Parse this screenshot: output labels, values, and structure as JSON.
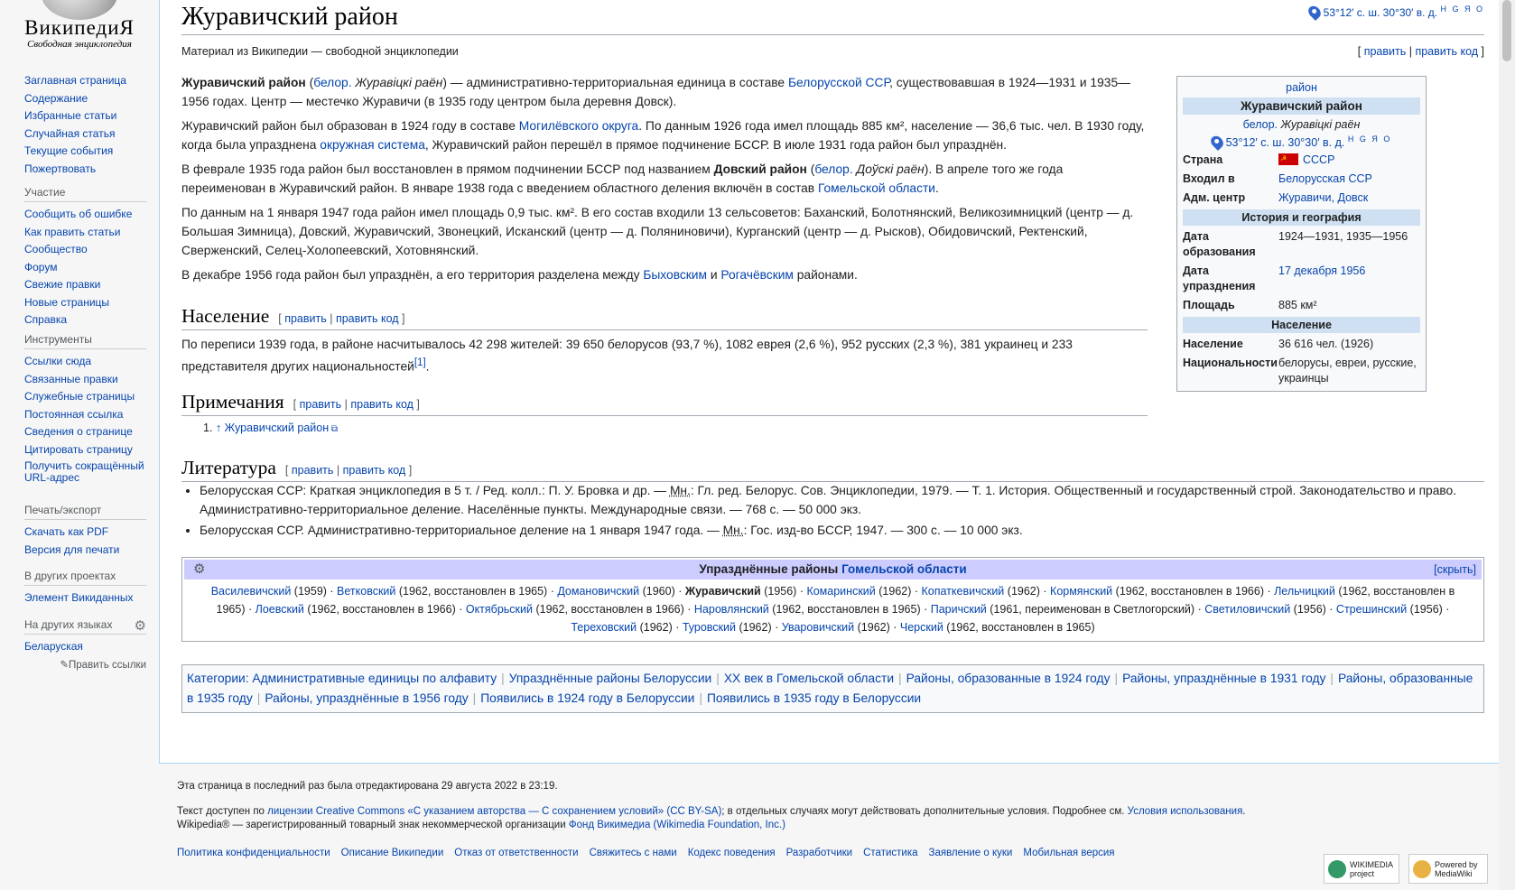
{
  "logo": {
    "wordmark": "ВикипедиЯ",
    "tagline": "Свободная энциклопедия"
  },
  "sidebar": {
    "nav": [
      "Заглавная страница",
      "Содержание",
      "Избранные статьи",
      "Случайная статья",
      "Текущие события",
      "Пожертвовать"
    ],
    "participation": {
      "heading": "Участие",
      "items": [
        "Сообщить об ошибке",
        "Как править статьи",
        "Сообщество",
        "Форум",
        "Свежие правки",
        "Новые страницы",
        "Справка"
      ]
    },
    "tools": {
      "heading": "Инструменты",
      "items": [
        "Ссылки сюда",
        "Связанные правки",
        "Служебные страницы",
        "Постоянная ссылка",
        "Сведения о странице",
        "Цитировать страницу",
        "Получить сокращённый URL-адрес"
      ]
    },
    "print": {
      "heading": "Печать/экспорт",
      "items": [
        "Скачать как PDF",
        "Версия для печати"
      ]
    },
    "projects": {
      "heading": "В других проектах",
      "items": [
        "Элемент Викиданных"
      ]
    },
    "languages": {
      "heading": "На других языках",
      "items": [
        "Беларуская"
      ],
      "edit_links": "Править ссылки"
    }
  },
  "page": {
    "title": "Журавичский район",
    "coords": "53°12′ с. ш. 30°30′ в. д.",
    "coords_sup": "H G Я O",
    "site_sub": "Материал из Википедии — свободной энциклопедии",
    "edit": "править",
    "edit_code": "править код"
  },
  "intro": {
    "p1": {
      "bold": "Журавичский район",
      "lang": "белор.",
      "lang_name": "Журавіцкі раён",
      "t1": " — административно-территориальная единица в составе ",
      "link1": "Белорусской ССР",
      "t2": ", существовавшая в 1924—1931 и 1935—1956 годах. Центр — местечко Журавичи (в 1935 году центром была деревня Довск)."
    },
    "p2": {
      "t1": "Журавичский район был образован в 1924 году в составе ",
      "link1": "Могилёвского округа",
      "t2": ". По данным 1926 года имел площадь 885 км², население — 36,6 тыс. чел. В 1930 году, когда была упразднена ",
      "link2": "окружная система",
      "t3": ", Журавичский район перешёл в прямое подчинение БССР. В июле 1931 года район был упразднён."
    },
    "p3": {
      "t1": "В феврале 1935 года район был восстановлен в прямом подчинении БССР под названием ",
      "bold": "Довский район",
      "lang": "белор.",
      "lang_name": "Доўскі раён",
      "t2": "). В апреле того же года переименован в Журавичский район. В январе 1938 года с введением областного деления включён в состав ",
      "link1": "Гомельской области",
      "t3": "."
    },
    "p4": "По данным на 1 января 1947 года район имел площадь 0,9 тыс. км². В его состав входили 13 сельсоветов: Баханский, Болотнянский, Великозимницкий (центр — д. Большая Зимница), Довский, Журавичский, Звонецкий, Исканский (центр — д. Поляниновичи), Курганский (центр — д. Рысков), Обидовичский, Ректенский, Сверженский, Селец-Холопеевский, Хотовнянский.",
    "p5": {
      "t1": "В декабре 1956 года район был упразднён, а его территория разделена между ",
      "link1": "Быховским",
      "t2": " и ",
      "link2": "Рогачёвским",
      "t3": " районами."
    }
  },
  "population": {
    "heading": "Население",
    "text": "По переписи 1939 года, в районе насчитывалось 42 298 жителей: 39 650 белорусов (93,7 %), 1082 еврея (2,6 %), 952 русских (2,3 %), 381 украинец и 233 представителя других национальностей",
    "ref": "[1]"
  },
  "notes": {
    "heading": "Примечания",
    "item_num": "1.",
    "arrow": "↑",
    "item": "Журавичский район"
  },
  "literature": {
    "heading": "Литература",
    "items": [
      {
        "t1": "Белорусская ССР: Краткая энциклопедия в 5 т. / Ред. колл.: П. У. Бровка и др. — ",
        "abbr": "Мн.",
        "t2": ": Гл. ред. Белорус. Сов. Энциклопедии, 1979. — Т. 1. История. Общественный и государственный строй. Законодательство и право. Административно-территориальное деление. Населённые пункты. Международные связи. — 768 с. — 50 000 экз."
      },
      {
        "t1": "Белорусская ССР. Административно-территориальное деление на 1 января 1947 года. — ",
        "abbr": "Мн.",
        "t2": ": Гос. изд-во БССР, 1947. — 300 с. — 10 000 экз."
      }
    ]
  },
  "infobox": {
    "top_link": "район",
    "title": "Журавичский район",
    "lang": "белор.",
    "lang_name": "Журавіцкі раён",
    "coords": "53°12′ с. ш. 30°30′ в. д.",
    "coords_sup": "H G Я O",
    "rows1": [
      {
        "label": "Страна",
        "value": "СССР",
        "flag": true
      },
      {
        "label": "Входил в",
        "value": "Белорусская ССР"
      },
      {
        "label": "Адм. центр",
        "value": "Журавичи, Довск"
      }
    ],
    "head2": "История и география",
    "rows2": [
      {
        "label": "Дата образования",
        "value": "1924—1931, 1935—1956",
        "link": false
      },
      {
        "label": "Дата упразднения",
        "value": "17 декабря 1956",
        "link": true
      },
      {
        "label": "Площадь",
        "value": "885 км²",
        "link": false
      }
    ],
    "head3": "Население",
    "rows3": [
      {
        "label": "Население",
        "value": "36 616 чел. (1926)"
      },
      {
        "label": "Национальности",
        "value": "белорусы, евреи, русские, украинцы"
      }
    ]
  },
  "navbox": {
    "title_text": "Упразднённые районы ",
    "title_link": "Гомельской области",
    "hide": "[скрыть]",
    "items": [
      {
        "name": "Василевичский",
        "note": "(1959)"
      },
      {
        "name": "Ветковский",
        "note": "(1962, восстановлен в 1965)"
      },
      {
        "name": "Домановичский",
        "note": "(1960)"
      },
      {
        "name": "Журавичский",
        "note": "(1956)",
        "bold": true
      },
      {
        "name": "Комаринский",
        "note": "(1962)"
      },
      {
        "name": "Копаткевичский",
        "note": "(1962)"
      },
      {
        "name": "Кормянский",
        "note": "(1962, восстановлен в 1966)"
      },
      {
        "name": "Лельчицкий",
        "note": "(1962, восстановлен в 1965)"
      },
      {
        "name": "Лоевский",
        "note": "(1962, восстановлен в 1966)"
      },
      {
        "name": "Октябрьский",
        "note": "(1962, восстановлен в 1966)"
      },
      {
        "name": "Наровлянский",
        "note": "(1962, восстановлен в 1965)"
      },
      {
        "name": "Паричский",
        "note": "(1961, переименован в Светлогорский)"
      },
      {
        "name": "Светиловичский",
        "note": "(1956)"
      },
      {
        "name": "Стрешинский",
        "note": "(1956)"
      },
      {
        "name": "Тереховский",
        "note": "(1962)"
      },
      {
        "name": "Туровский",
        "note": "(1962)"
      },
      {
        "name": "Уваровичский",
        "note": "(1962)"
      },
      {
        "name": "Черский",
        "note": "(1962, восстановлен в 1965)"
      }
    ]
  },
  "categories": {
    "label": "Категории:",
    "items": [
      "Административные единицы по алфавиту",
      "Упразднённые районы Белоруссии",
      "XX век в Гомельской области",
      "Районы, образованные в 1924 году",
      "Районы, упразднённые в 1931 году",
      "Районы, образованные в 1935 году",
      "Районы, упразднённые в 1956 году",
      "Появились в 1924 году в Белоруссии",
      "Появились в 1935 году в Белоруссии"
    ]
  },
  "footer": {
    "last_edit": "Эта страница в последний раз была отредактирована 29 августа 2022 в 23:19.",
    "license_t1": "Текст доступен по ",
    "license_link": "лицензии Creative Commons «С указанием авторства — С сохранением условий» (CC BY-SA)",
    "license_t2": "; в отдельных случаях могут действовать дополнительные условия. Подробнее см. ",
    "terms_link": "Условия использования",
    "license_t3": ".",
    "trademark_t1": "Wikipedia® — зарегистрированный товарный знак некоммерческой организации ",
    "trademark_link": "Фонд Викимедиа (Wikimedia Foundation, Inc.)",
    "links": [
      "Политика конфиденциальности",
      "Описание Википедии",
      "Отказ от ответственности",
      "Свяжитесь с нами",
      "Кодекс поведения",
      "Разработчики",
      "Статистика",
      "Заявление о куки",
      "Мобильная версия"
    ],
    "badge1": "WIKIMEDIA project",
    "badge2": "Powered by MediaWiki"
  }
}
